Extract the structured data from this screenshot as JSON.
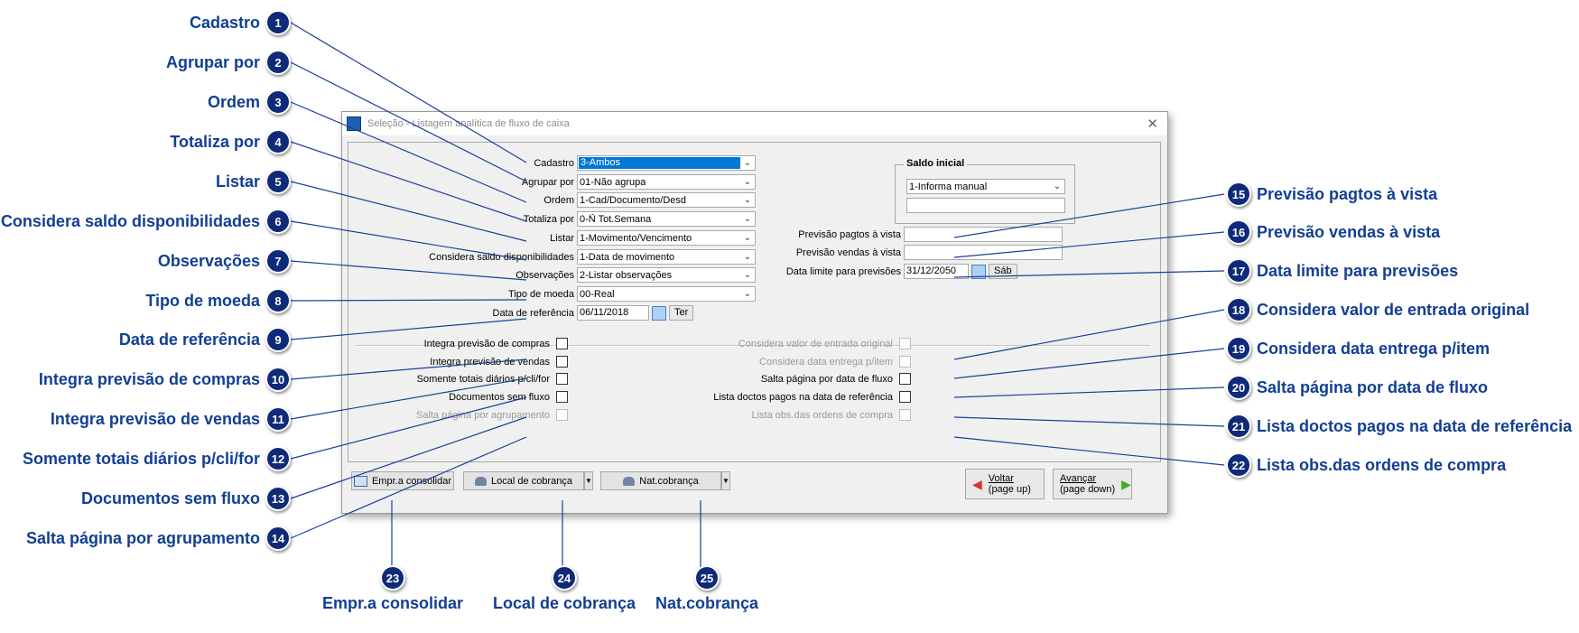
{
  "dialog": {
    "title": "Seleção - Listagem analítica de fluxo de caixa",
    "close_glyph": "✕"
  },
  "fields": {
    "cadastro": {
      "label": "Cadastro",
      "value": "3-Ambos"
    },
    "agrupar_por": {
      "label": "Agrupar por",
      "value": "01-Não agrupa"
    },
    "ordem": {
      "label": "Ordem",
      "value": "1-Cad/Documento/Desd"
    },
    "totaliza_por": {
      "label": "Totaliza por",
      "value": "0-Ñ Tot.Semana"
    },
    "listar": {
      "label": "Listar",
      "value": "1-Movimento/Vencimento"
    },
    "considera_saldo": {
      "label": "Considera saldo disponibilidades",
      "value": "1-Data de movimento"
    },
    "observacoes": {
      "label": "Observações",
      "value": "2-Listar observações"
    },
    "tipo_moeda": {
      "label": "Tipo de moeda",
      "value": "00-Real"
    },
    "data_referencia": {
      "label": "Data de referência",
      "value": "06/11/2018",
      "day": "Ter"
    }
  },
  "saldo_inicial": {
    "title": "Saldo inicial",
    "value": "1-Informa manual",
    "amount": ""
  },
  "right_fields": {
    "prev_pagtos": {
      "label": "Previsão pagtos à vista",
      "value": ""
    },
    "prev_vendas": {
      "label": "Previsão vendas à vista",
      "value": ""
    },
    "data_limite": {
      "label": "Data limite para previsões",
      "value": "31/12/2050",
      "day": "Sáb"
    }
  },
  "checks_left": [
    {
      "label": "Integra previsão de compras",
      "checked": false,
      "disabled": false
    },
    {
      "label": "Integra previsão de vendas",
      "checked": false,
      "disabled": false
    },
    {
      "label": "Somente totais diários p/cli/for",
      "checked": false,
      "disabled": false
    },
    {
      "label": "Documentos sem fluxo",
      "checked": false,
      "disabled": false
    },
    {
      "label": "Salta página por agrupamento",
      "checked": false,
      "disabled": true
    }
  ],
  "checks_right": [
    {
      "label": "Considera valor de entrada original",
      "checked": false,
      "disabled": true
    },
    {
      "label": "Considera data entrega p/item",
      "checked": false,
      "disabled": true
    },
    {
      "label": "Salta página por data de fluxo",
      "checked": false,
      "disabled": false
    },
    {
      "label": "Lista doctos pagos na data de referência",
      "checked": false,
      "disabled": false
    },
    {
      "label": "Lista obs.das ordens de compra",
      "checked": false,
      "disabled": true
    }
  ],
  "buttons": {
    "empr": "Empr.a consolidar",
    "local": "Local de cobrança",
    "nat": "Nat.cobrança",
    "voltar_1": "Voltar",
    "voltar_2": "(page up)",
    "avancar_1": "Avançar",
    "avancar_2": "(page down)"
  },
  "callouts": [
    {
      "n": "1",
      "label": "Cadastro"
    },
    {
      "n": "2",
      "label": "Agrupar por"
    },
    {
      "n": "3",
      "label": "Ordem"
    },
    {
      "n": "4",
      "label": "Totaliza por"
    },
    {
      "n": "5",
      "label": "Listar"
    },
    {
      "n": "6",
      "label": "Considera saldo disponibilidades"
    },
    {
      "n": "7",
      "label": "Observações"
    },
    {
      "n": "8",
      "label": "Tipo de moeda"
    },
    {
      "n": "9",
      "label": "Data de referência"
    },
    {
      "n": "10",
      "label": "Integra previsão de compras"
    },
    {
      "n": "11",
      "label": "Integra previsão de vendas"
    },
    {
      "n": "12",
      "label": "Somente totais diários p/cli/for"
    },
    {
      "n": "13",
      "label": "Documentos sem fluxo"
    },
    {
      "n": "14",
      "label": "Salta página por agrupamento"
    },
    {
      "n": "15",
      "label": "Previsão pagtos à vista"
    },
    {
      "n": "16",
      "label": "Previsão vendas à vista"
    },
    {
      "n": "17",
      "label": "Data limite para previsões"
    },
    {
      "n": "18",
      "label": "Considera valor de entrada original"
    },
    {
      "n": "19",
      "label": "Considera data entrega p/item"
    },
    {
      "n": "20",
      "label": "Salta página por data de fluxo"
    },
    {
      "n": "21",
      "label": "Lista doctos pagos na data de referência"
    },
    {
      "n": "22",
      "label": "Lista obs.das ordens de compra"
    },
    {
      "n": "23",
      "label": "Empr.a consolidar"
    },
    {
      "n": "24",
      "label": "Local de cobrança"
    },
    {
      "n": "25",
      "label": "Nat.cobrança"
    }
  ],
  "colors": {
    "badge": "#0f2a78",
    "callout_text": "#123f93",
    "connector": "#1b3f99",
    "selection": "#0078d7"
  }
}
